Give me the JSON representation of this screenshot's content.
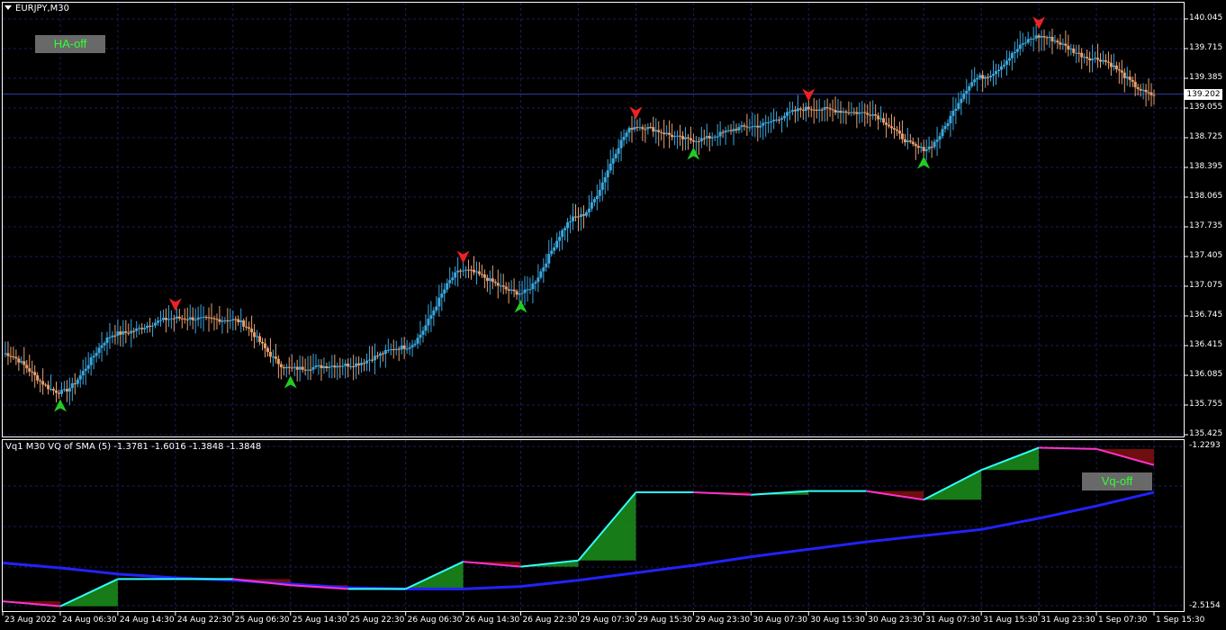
{
  "window": {
    "symbol_title": "EURJPY,M30"
  },
  "buttons": {
    "ha_label": "HA-off",
    "vq_label": "Vq-off",
    "label_color": "#33ff33",
    "bg_color": "#696969"
  },
  "price_axis": {
    "labels": [
      "140.045",
      "139.715",
      "139.385",
      "139.055",
      "138.725",
      "138.395",
      "138.065",
      "137.735",
      "137.405",
      "137.075",
      "136.745",
      "136.415",
      "136.085",
      "135.755",
      "135.425"
    ],
    "current_price": "139.202"
  },
  "indicator": {
    "title": "Vq1 M30 VQ of SMA (5) -1.3781 -1.6016 -1.3848 -1.3848",
    "axis_top": "-1.2293",
    "axis_bottom": "-2.5154"
  },
  "time_axis": {
    "labels": [
      "23 Aug 2022",
      "24 Aug 06:30",
      "24 Aug 14:30",
      "24 Aug 22:30",
      "25 Aug 06:30",
      "25 Aug 14:30",
      "25 Aug 22:30",
      "26 Aug 06:30",
      "26 Aug 14:30",
      "26 Aug 22:30",
      "29 Aug 07:30",
      "29 Aug 15:30",
      "29 Aug 23:30",
      "30 Aug 07:30",
      "30 Aug 15:30",
      "30 Aug 23:30",
      "31 Aug 07:30",
      "31 Aug 15:30",
      "31 Aug 23:30",
      "1 Sep 07:30",
      "1 Sep 15:30"
    ]
  },
  "colors": {
    "background": "#000000",
    "grid": "#1c1c5a",
    "bull_candle": "#3aa8e0",
    "bear_candle": "#e8a070",
    "buy_arrow": "#22cc22",
    "sell_arrow": "#ee2222",
    "vq_line_up": "#33ffff",
    "vq_line_down": "#ff33cc",
    "ma_line": "#2222ff",
    "fill_up": "#1a8a1a",
    "fill_down": "#7a1010"
  },
  "chart_data": [
    {
      "type": "candlestick",
      "title": "EURJPY,M30",
      "ylim": [
        135.425,
        140.045
      ],
      "x": [
        "23 Aug 2022",
        "24 Aug 06:30",
        "24 Aug 14:30",
        "24 Aug 22:30",
        "25 Aug 06:30",
        "25 Aug 14:30",
        "25 Aug 22:30",
        "26 Aug 06:30",
        "26 Aug 14:30",
        "26 Aug 22:30",
        "29 Aug 07:30",
        "29 Aug 15:30",
        "29 Aug 23:30",
        "30 Aug 07:30",
        "30 Aug 15:30",
        "30 Aug 23:30",
        "31 Aug 07:30",
        "31 Aug 15:30",
        "31 Aug 23:30",
        "1 Sep 07:30",
        "1 Sep 15:30"
      ],
      "close": [
        136.33,
        135.9,
        136.55,
        136.72,
        136.7,
        136.16,
        136.2,
        136.4,
        137.25,
        137.0,
        137.85,
        138.85,
        138.7,
        138.85,
        139.05,
        139.0,
        138.6,
        139.4,
        139.85,
        139.6,
        139.2
      ],
      "current_price": 139.202,
      "grid": true
    },
    {
      "type": "line",
      "title": "Vq1 M30 VQ of SMA (5)",
      "ylim": [
        -2.5154,
        -1.2293
      ],
      "x": [
        "23 Aug 2022",
        "24 Aug 06:30",
        "24 Aug 14:30",
        "24 Aug 22:30",
        "25 Aug 06:30",
        "25 Aug 14:30",
        "25 Aug 22:30",
        "26 Aug 06:30",
        "26 Aug 14:30",
        "26 Aug 22:30",
        "29 Aug 07:30",
        "29 Aug 15:30",
        "29 Aug 23:30",
        "30 Aug 07:30",
        "30 Aug 15:30",
        "30 Aug 23:30",
        "31 Aug 07:30",
        "31 Aug 15:30",
        "31 Aug 23:30",
        "1 Sep 07:30",
        "1 Sep 15:30"
      ],
      "series": [
        {
          "values": [
            -2.48,
            -2.52,
            -2.3,
            -2.3,
            -2.3,
            -2.35,
            -2.38,
            -2.38,
            -2.16,
            -2.2,
            -2.15,
            -1.6,
            -1.6,
            -1.62,
            -1.59,
            -1.59,
            -1.66,
            -1.42,
            -1.24,
            -1.25,
            -1.38
          ]
        },
        {
          "values": [
            -2.17,
            -2.21,
            -2.26,
            -2.29,
            -2.31,
            -2.34,
            -2.37,
            -2.38,
            -2.38,
            -2.36,
            -2.31,
            -2.25,
            -2.19,
            -2.12,
            -2.06,
            -2.0,
            -1.95,
            -1.9,
            -1.81,
            -1.71,
            -1.6
          ]
        }
      ],
      "grid": true
    }
  ]
}
